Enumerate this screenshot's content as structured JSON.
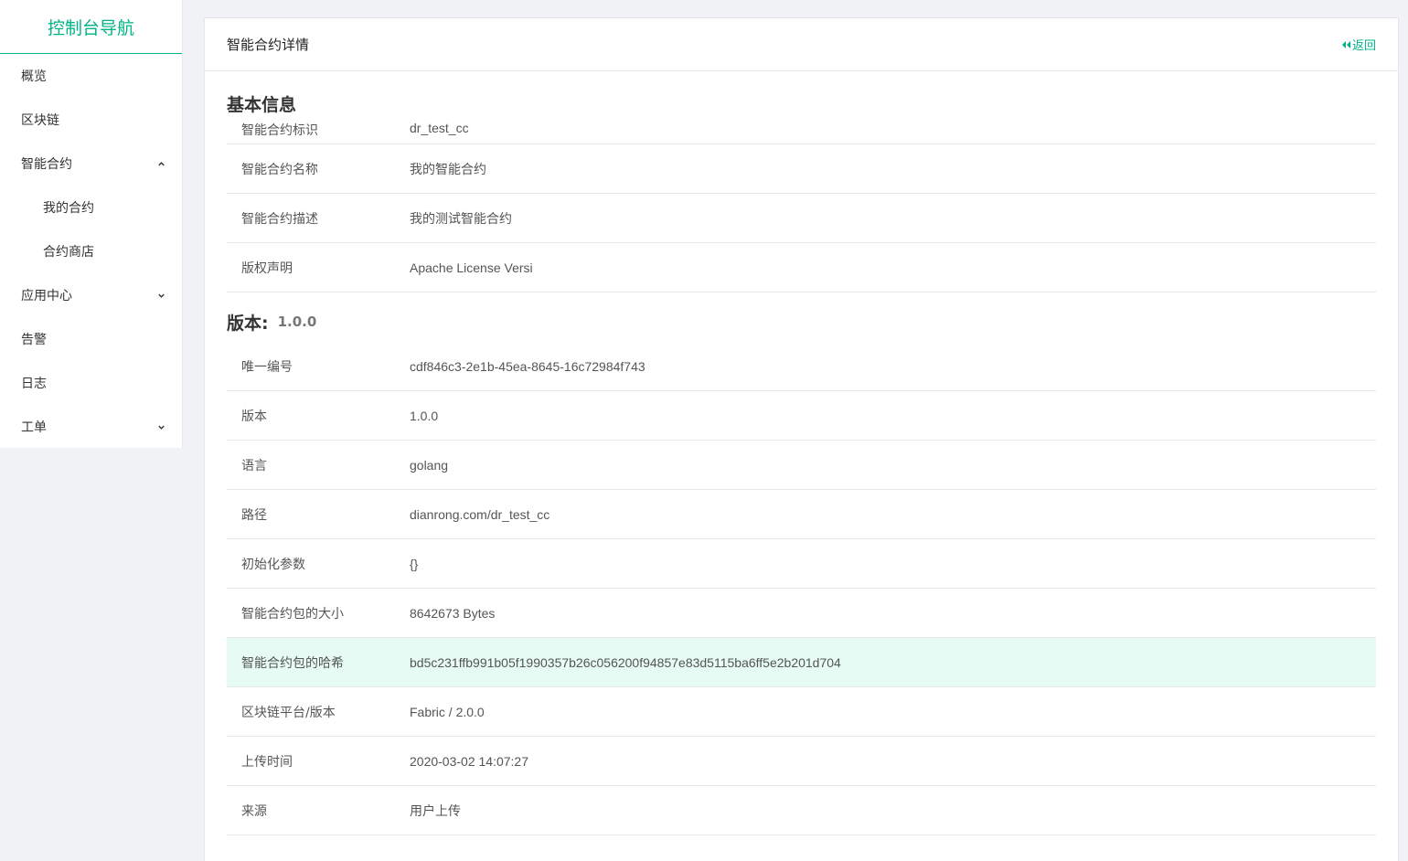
{
  "sidebar": {
    "brand": "控制台导航",
    "items": [
      {
        "label": "概览"
      },
      {
        "label": "区块链"
      },
      {
        "label": "智能合约"
      },
      {
        "label": "我的合约"
      },
      {
        "label": "合约商店"
      },
      {
        "label": "应用中心"
      },
      {
        "label": "告警"
      },
      {
        "label": "日志"
      },
      {
        "label": "工单"
      }
    ]
  },
  "header": {
    "title": "智能合约详情",
    "back_label": "返回"
  },
  "basic": {
    "heading": "基本信息",
    "rows": [
      {
        "label": "智能合约标识",
        "value": "dr_test_cc"
      },
      {
        "label": "智能合约名称",
        "value": "我的智能合约"
      },
      {
        "label": "智能合约描述",
        "value": "我的测试智能合约"
      },
      {
        "label": "版权声明",
        "value": "Apache License Versi"
      }
    ]
  },
  "version": {
    "heading": "版本:",
    "number": "1.0.0",
    "rows": [
      {
        "label": "唯一编号",
        "value": "cdf846c3-2e1b-45ea-8645-16c72984f743"
      },
      {
        "label": "版本",
        "value": "1.0.0"
      },
      {
        "label": "语言",
        "value": "golang"
      },
      {
        "label": "路径",
        "value": "dianrong.com/dr_test_cc"
      },
      {
        "label": "初始化参数",
        "value": "{}"
      },
      {
        "label": "智能合约包的大小",
        "value": "8642673 Bytes"
      },
      {
        "label": "智能合约包的哈希",
        "value": "bd5c231ffb991b05f1990357b26c056200f94857e83d5115ba6ff5e2b201d704"
      },
      {
        "label": "区块链平台/版本",
        "value": "Fabric / 2.0.0"
      },
      {
        "label": "上传时间",
        "value": "2020-03-02 14:07:27"
      },
      {
        "label": "来源",
        "value": "用户上传"
      }
    ]
  },
  "colors": {
    "accent": "#00b386",
    "highlight_row": "#e6fbf3"
  }
}
